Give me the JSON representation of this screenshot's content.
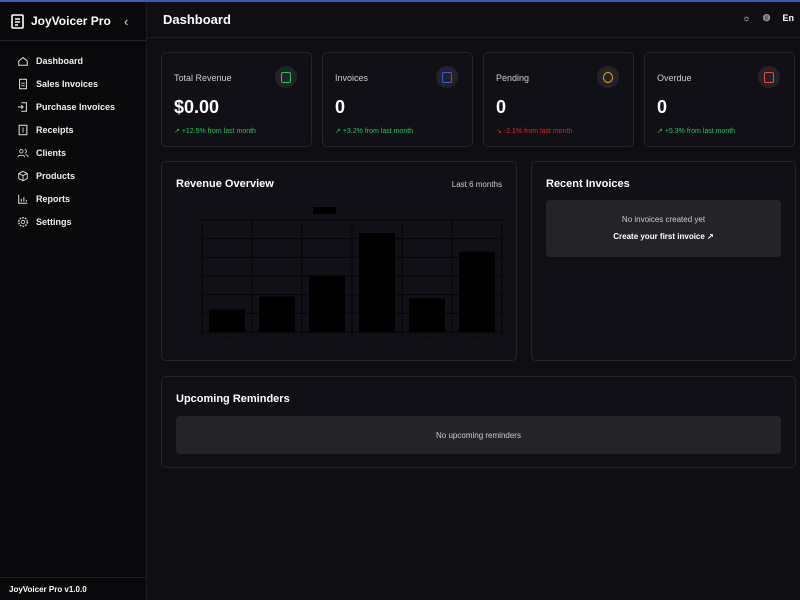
{
  "app": {
    "name": "JoyVoicer Pro",
    "version": "JoyVoicer Pro v1.0.0"
  },
  "sidebar": {
    "items": [
      {
        "label": "Dashboard",
        "icon": "home-icon"
      },
      {
        "label": "Sales Invoices",
        "icon": "file-icon"
      },
      {
        "label": "Purchase Invoices",
        "icon": "file-import-icon"
      },
      {
        "label": "Receipts",
        "icon": "receipt-icon"
      },
      {
        "label": "Clients",
        "icon": "users-icon"
      },
      {
        "label": "Products",
        "icon": "box-icon"
      },
      {
        "label": "Reports",
        "icon": "bar-chart-icon"
      },
      {
        "label": "Settings",
        "icon": "gear-icon"
      }
    ]
  },
  "header": {
    "title": "Dashboard",
    "lang": "En"
  },
  "stats": [
    {
      "label": "Total Revenue",
      "value": "$0.00",
      "change": "+12.5% from last month",
      "trend": "up",
      "color": "#22c55e"
    },
    {
      "label": "Invoices",
      "value": "0",
      "change": "+3.2% from last month",
      "trend": "up",
      "color": "#3b5bdb"
    },
    {
      "label": "Pending",
      "value": "0",
      "change": "-2.1% from last month",
      "trend": "down",
      "color": "#d4a017"
    },
    {
      "label": "Overdue",
      "value": "0",
      "change": "+5.3% from last month",
      "trend": "up",
      "color": "#ef4444"
    }
  ],
  "revenue": {
    "title": "Revenue Overview",
    "range": "Last 6 months"
  },
  "chart_data": {
    "type": "bar",
    "title": "",
    "categories": [
      "Jan",
      "Feb",
      "Mar",
      "Apr",
      "May",
      "Jun"
    ],
    "values": [
      1200,
      1900,
      3000,
      5300,
      1800,
      4300
    ],
    "ylim": [
      0,
      6000
    ],
    "grid": true,
    "legend": "top"
  },
  "recent": {
    "title": "Recent Invoices",
    "empty": "No invoices created yet",
    "cta": "Create your first invoice ↗"
  },
  "reminders": {
    "title": "Upcoming Reminders",
    "empty": "No upcoming reminders"
  }
}
